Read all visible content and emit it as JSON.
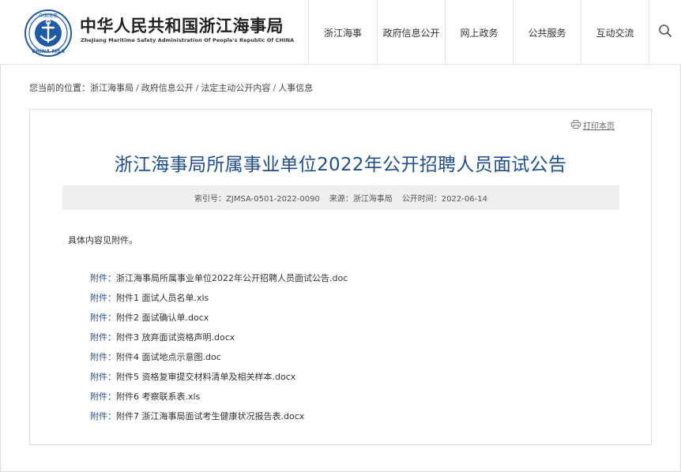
{
  "header": {
    "brand_cn": "中华人民共和国浙江海事局",
    "brand_en": "ZheJiang Maritime Safety Administration Of People's Republic Of CHINA",
    "logo_text": "CHINA MSA",
    "nav": [
      {
        "label": "浙江海事"
      },
      {
        "label": "政府信息公开"
      },
      {
        "label": "网上政务"
      },
      {
        "label": "公共服务"
      },
      {
        "label": "互动交流"
      }
    ],
    "search_icon": "search-icon"
  },
  "breadcrumb": {
    "prefix": "您当前的位置：",
    "items": [
      "浙江海事局",
      "政府信息公开",
      "法定主动公开内容",
      "人事信息"
    ],
    "separator": "/"
  },
  "article": {
    "print_label": "打印本页",
    "print_icon": "printer-icon",
    "title": "浙江海事局所属事业单位2022年公开招聘人员面试公告",
    "meta": {
      "index": "索引号：ZJMSA-0501-2022-0090",
      "source": "来源：浙江海事局",
      "date": "公开时间：2022-06-14"
    },
    "body": "具体内容见附件。",
    "attachment_label": "附件：",
    "attachments": [
      "浙江海事局所属事业单位2022年公开招聘人员面试公告.doc",
      "附件1 面试人员名单.xls",
      "附件2 面试确认单.docx",
      "附件3 放弃面试资格声明.docx",
      "附件4 面试地点示意图.doc",
      "附件5 资格复审提交材料清单及相关样本.docx",
      "附件6 考察联系表.xls",
      "附件7 浙江海事局面试考生健康状况报告表.docx"
    ]
  },
  "colors": {
    "title_blue": "#1f4f8f",
    "meta_bg": "#efefef",
    "border": "#dcdcdc"
  }
}
